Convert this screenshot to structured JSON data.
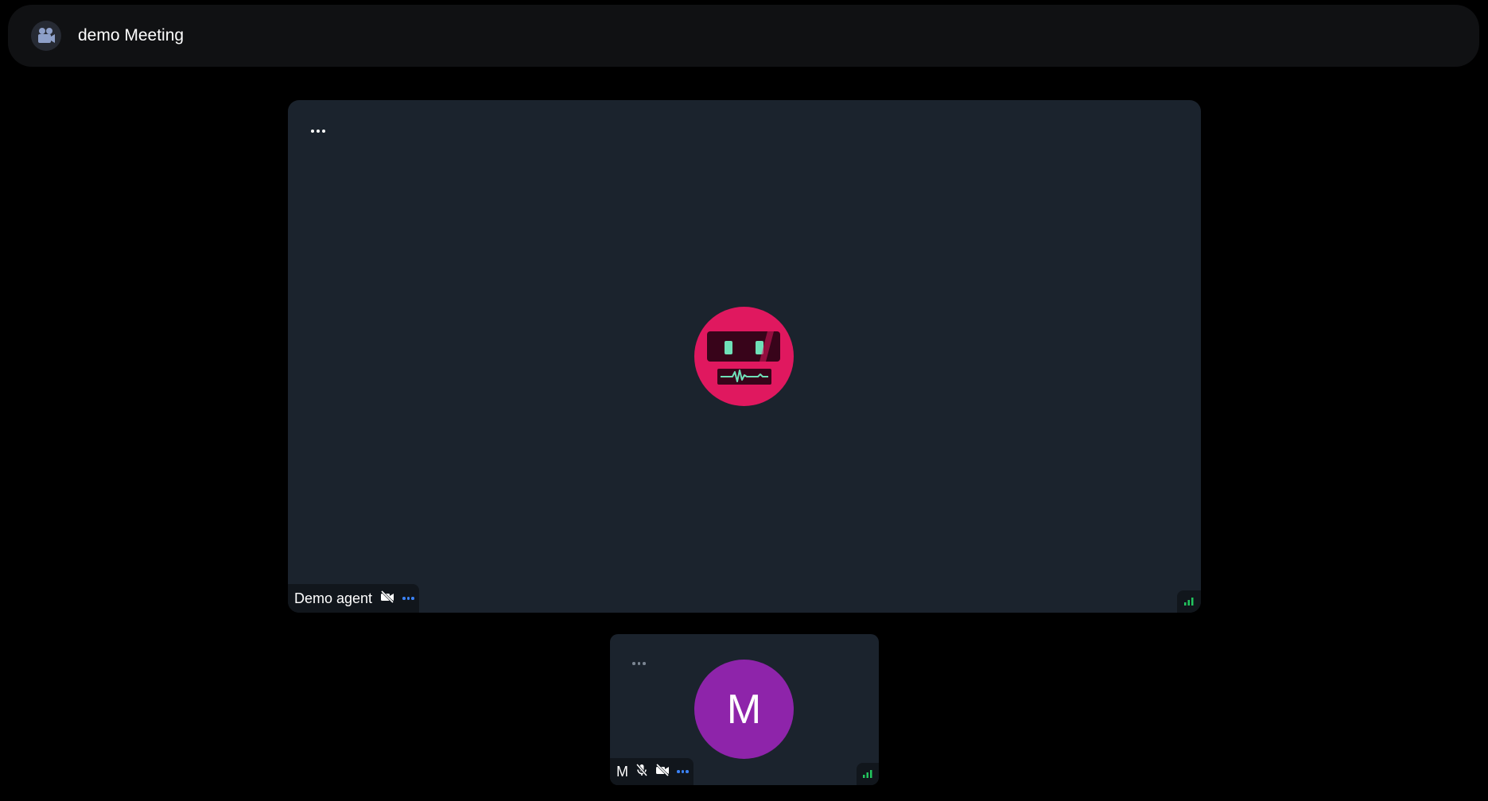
{
  "header": {
    "title": "demo Meeting",
    "icon": "video-camera-icon"
  },
  "main_tile": {
    "participant_name": "Demo agent",
    "avatar": "robot-avatar-icon",
    "avatar_color": "#e0185f",
    "camera_status": "camera-off-icon",
    "signal_color": "#22c55e"
  },
  "self_tile": {
    "participant_name": "M",
    "avatar_initial": "M",
    "avatar_color": "#8e24aa",
    "mic_status": "mic-off-icon",
    "camera_status": "camera-off-icon",
    "signal_color": "#22c55e"
  },
  "colors": {
    "background": "#000000",
    "tile": "#1b232d",
    "header": "#101113",
    "accent_blue": "#3b82f6"
  }
}
